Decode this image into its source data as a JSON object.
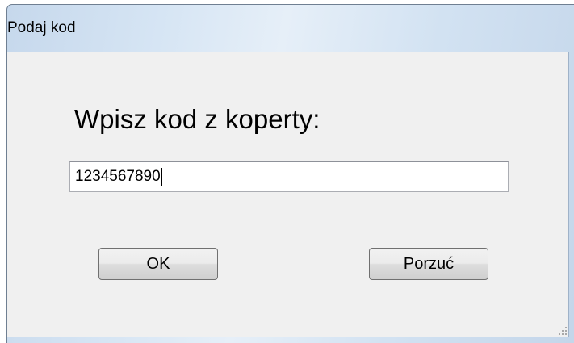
{
  "window": {
    "title": "Podaj kod"
  },
  "dialog": {
    "prompt": "Wpisz kod z koperty:",
    "code_value": "1234567890",
    "ok_label": "OK",
    "cancel_label": "Porzuć"
  },
  "colors": {
    "client_background": "#f0f0f0",
    "titlebar_tint": "#d6e5f4",
    "button_border": "#707070"
  },
  "icons": {
    "resize_grip": "size-grip-icon"
  }
}
